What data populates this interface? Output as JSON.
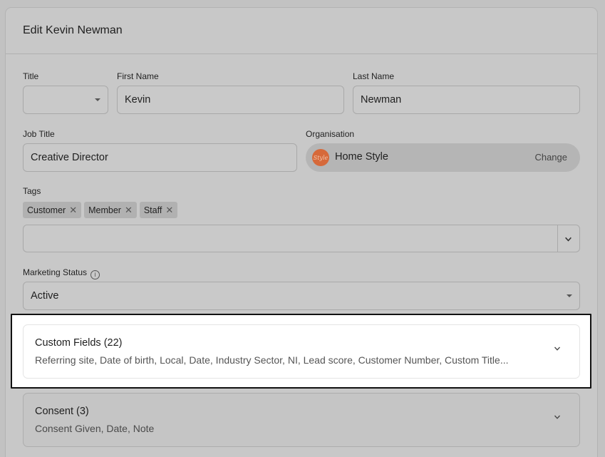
{
  "header": {
    "title": "Edit Kevin Newman"
  },
  "fields": {
    "title": {
      "label": "Title",
      "value": ""
    },
    "first_name": {
      "label": "First Name",
      "value": "Kevin"
    },
    "last_name": {
      "label": "Last Name",
      "value": "Newman"
    },
    "job_title": {
      "label": "Job Title",
      "value": "Creative Director"
    },
    "organisation": {
      "label": "Organisation",
      "name": "Home Style",
      "avatar_text": "Style",
      "change_label": "Change",
      "avatar_color": "#d6693a"
    },
    "tags": {
      "label": "Tags",
      "items": [
        "Customer",
        "Member",
        "Staff"
      ],
      "remove_glyph": "✕"
    },
    "marketing_status": {
      "label": "Marketing Status",
      "value": "Active",
      "info_glyph": "i"
    }
  },
  "panels": {
    "custom_fields": {
      "title": "Custom Fields (22)",
      "summary": "Referring site, Date of birth, Local, Date, Industry Sector, NI, Lead score, Customer Number, Custom Title..."
    },
    "consent": {
      "title": "Consent (3)",
      "summary": "Consent Given, Date, Note"
    }
  },
  "icons": {
    "dropdown": "chevron-down-icon",
    "remove": "close-icon",
    "info": "info-icon"
  }
}
